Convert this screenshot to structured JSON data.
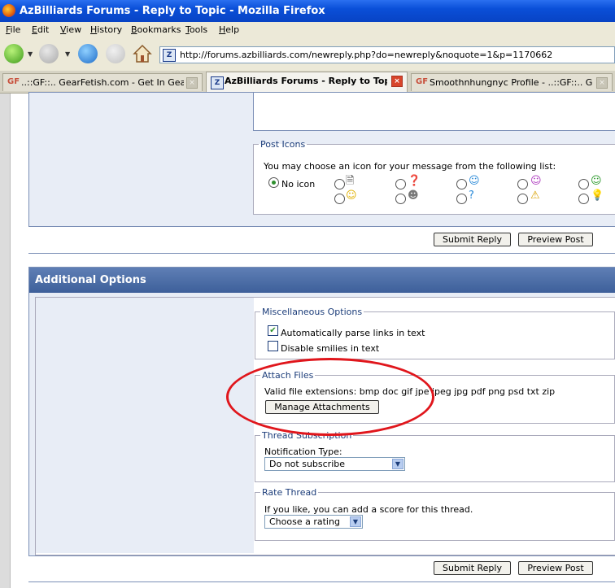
{
  "window": {
    "title": "AzBilliards Forums - Reply to Topic - Mozilla Firefox"
  },
  "menu": [
    {
      "first": "F",
      "rest": "ile"
    },
    {
      "first": "E",
      "rest": "dit"
    },
    {
      "first": "V",
      "rest": "iew"
    },
    {
      "first": "H",
      "rest": "istory"
    },
    {
      "first": "B",
      "rest": "ookmarks"
    },
    {
      "first": "T",
      "rest": "ools"
    },
    {
      "first": "H",
      "rest": "elp"
    }
  ],
  "navbar": {
    "url": "http://forums.azbilliards.com/newreply.php?do=newreply&noquote=1&p=1170662"
  },
  "tabs": [
    {
      "icon": "GF",
      "label": "..::GF::.. GearFetish.com - Get In Gear"
    },
    {
      "icon": "AZ",
      "label": "AzBilliards Forums - Reply to Topic"
    },
    {
      "icon": "GF",
      "label": "Smoothnhungnyc Profile - ..::GF::.. G..."
    }
  ],
  "post_icons": {
    "legend": "Post Icons",
    "prompt": "You may choose an icon for your message from the following list:",
    "no_icon": "No icon"
  },
  "buttons": {
    "submit": "Submit Reply",
    "preview": "Preview Post"
  },
  "additional_options": {
    "title": "Additional Options",
    "misc": {
      "legend": "Miscellaneous Options",
      "parse_links": "Automatically parse links in text",
      "disable_smilies": "Disable smilies in text"
    },
    "attach": {
      "legend": "Attach Files",
      "valid_ext": "Valid file extensions: bmp doc gif jpe jpeg jpg pdf png psd txt zip",
      "manage": "Manage Attachments"
    },
    "subscription": {
      "legend": "Thread Subscription",
      "label": "Notification Type:",
      "value": "Do not subscribe"
    },
    "rate": {
      "legend": "Rate Thread",
      "label": "If you like, you can add a score for this thread.",
      "value": "Choose a rating"
    }
  }
}
